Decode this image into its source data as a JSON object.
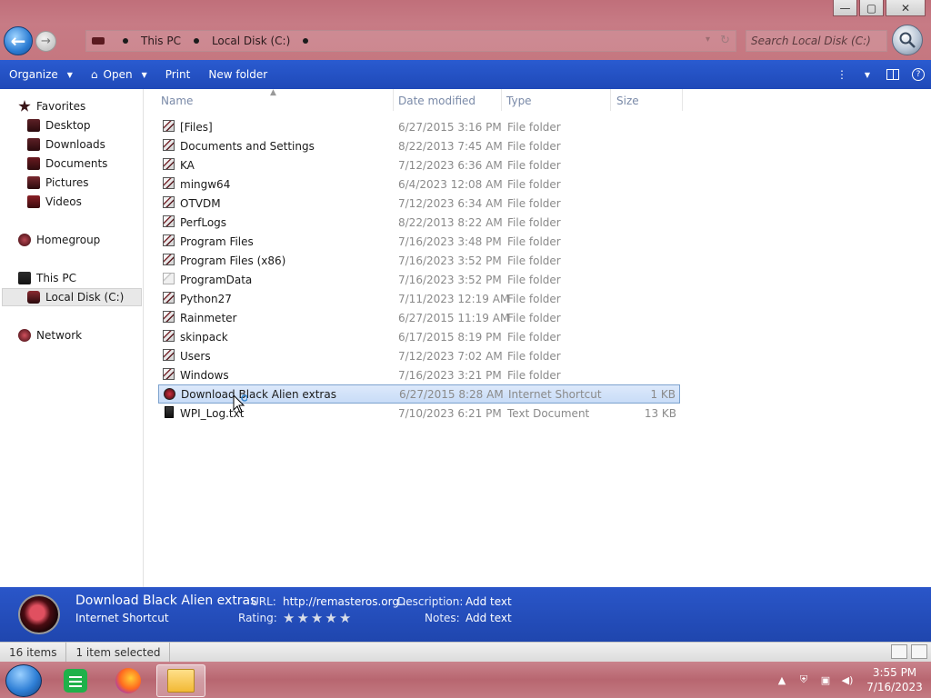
{
  "window": {
    "controls": {
      "minimize": "—",
      "maximize": "▢",
      "close": "✕"
    }
  },
  "address": {
    "segments": [
      "This PC",
      "Local Disk (C:)"
    ],
    "search_placeholder": "Search Local Disk (C:)"
  },
  "toolbar": {
    "organize": "Organize",
    "open": "Open",
    "print": "Print",
    "new_folder": "New folder",
    "help": "?"
  },
  "nav": {
    "favorites": "Favorites",
    "desktop": "Desktop",
    "downloads": "Downloads",
    "documents": "Documents",
    "pictures": "Pictures",
    "videos": "Videos",
    "homegroup": "Homegroup",
    "this_pc": "This PC",
    "local_disk": "Local Disk (C:)",
    "network": "Network"
  },
  "columns": {
    "name": "Name",
    "date": "Date modified",
    "type": "Type",
    "size": "Size"
  },
  "files": [
    {
      "name": "[Files]",
      "date": "6/27/2015 3:16 PM",
      "type": "File folder",
      "size": ""
    },
    {
      "name": "Documents and Settings",
      "date": "8/22/2013 7:45 AM",
      "type": "File folder",
      "size": ""
    },
    {
      "name": "KA",
      "date": "7/12/2023 6:36 AM",
      "type": "File folder",
      "size": ""
    },
    {
      "name": "mingw64",
      "date": "6/4/2023 12:08 AM",
      "type": "File folder",
      "size": ""
    },
    {
      "name": "OTVDM",
      "date": "7/12/2023 6:34 AM",
      "type": "File folder",
      "size": ""
    },
    {
      "name": "PerfLogs",
      "date": "8/22/2013 8:22 AM",
      "type": "File folder",
      "size": ""
    },
    {
      "name": "Program Files",
      "date": "7/16/2023 3:48 PM",
      "type": "File folder",
      "size": ""
    },
    {
      "name": "Program Files (x86)",
      "date": "7/16/2023 3:52 PM",
      "type": "File folder",
      "size": ""
    },
    {
      "name": "ProgramData",
      "date": "7/16/2023 3:52 PM",
      "type": "File folder",
      "size": ""
    },
    {
      "name": "Python27",
      "date": "7/11/2023 12:19 AM",
      "type": "File folder",
      "size": ""
    },
    {
      "name": "Rainmeter",
      "date": "6/27/2015 11:19 AM",
      "type": "File folder",
      "size": ""
    },
    {
      "name": "skinpack",
      "date": "6/17/2015 8:19 PM",
      "type": "File folder",
      "size": ""
    },
    {
      "name": "Users",
      "date": "7/12/2023 7:02 AM",
      "type": "File folder",
      "size": ""
    },
    {
      "name": "Windows",
      "date": "7/16/2023 3:21 PM",
      "type": "File folder",
      "size": ""
    },
    {
      "name": "Download Black Alien extras",
      "date": "6/27/2015 8:28 AM",
      "type": "Internet Shortcut",
      "size": "1 KB"
    },
    {
      "name": "WPI_Log.txt",
      "date": "7/10/2023 6:21 PM",
      "type": "Text Document",
      "size": "13 KB"
    }
  ],
  "details": {
    "title": "Download Black Alien extras",
    "type": "Internet Shortcut",
    "url_label": "URL:",
    "url_value": "http://remasteros.org...",
    "rating_label": "Rating:",
    "description_label": "Description:",
    "description_value": "Add text",
    "notes_label": "Notes:",
    "notes_value": "Add text",
    "stars": [
      "★",
      "★",
      "★",
      "★",
      "★"
    ]
  },
  "status": {
    "items": "16 items",
    "selected": "1 item selected"
  },
  "taskbar": {
    "time": "3:55 PM",
    "date": "7/16/2023"
  },
  "colors": {
    "title_bg": "#c77b85",
    "command_bar": "#2550c4",
    "details_pane": "#2450c0",
    "selection": "#cfe0f8"
  }
}
